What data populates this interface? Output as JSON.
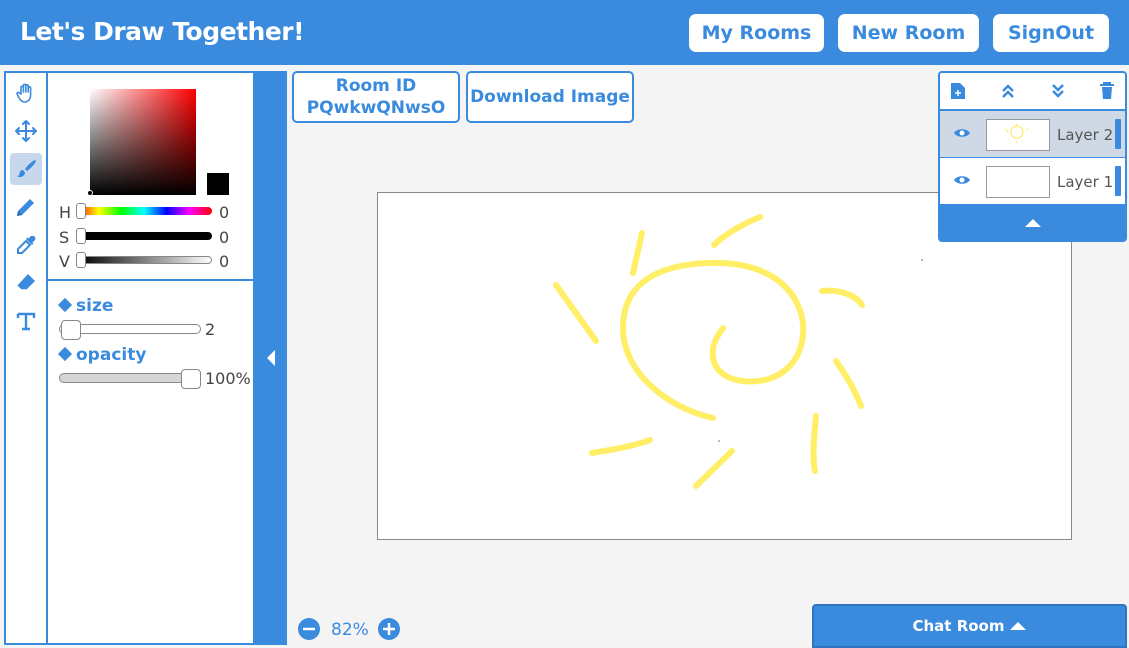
{
  "header": {
    "title": "Let's Draw Together!",
    "my_rooms": "My Rooms",
    "new_room": "New Room",
    "sign_out": "SignOut"
  },
  "tools": [
    {
      "name": "hand-icon",
      "active": false
    },
    {
      "name": "move-icon",
      "active": false
    },
    {
      "name": "brush-icon",
      "active": true
    },
    {
      "name": "pencil-icon",
      "active": false
    },
    {
      "name": "eyedropper-icon",
      "active": false
    },
    {
      "name": "eraser-icon",
      "active": false
    },
    {
      "name": "text-icon",
      "active": false
    }
  ],
  "color": {
    "h_label": "H",
    "h_value": "0",
    "s_label": "S",
    "s_value": "0",
    "v_label": "V",
    "v_value": "0",
    "current": "#000000"
  },
  "brush": {
    "size_label": "size",
    "size_value": "2",
    "size_fraction": 0.02,
    "opacity_label": "opacity",
    "opacity_value": "100%",
    "opacity_fraction": 1.0
  },
  "room": {
    "id_label": "Room ID",
    "id_value": "PQwkwQNwsO",
    "download_label": "Download Image"
  },
  "layers": [
    {
      "name": "Layer 2",
      "active": true
    },
    {
      "name": "Layer 1",
      "active": false
    }
  ],
  "zoom": {
    "value": "82%"
  },
  "chat": {
    "label": "Chat Room"
  },
  "colors": {
    "accent": "#3a8ade",
    "stroke": "#ffee66"
  }
}
